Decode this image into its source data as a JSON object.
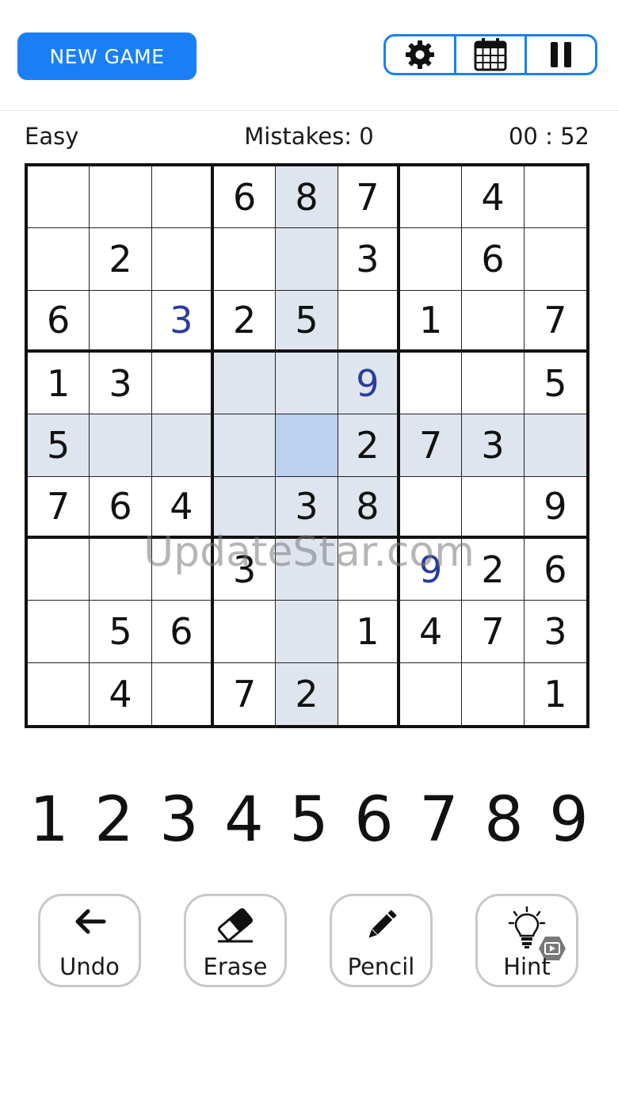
{
  "header": {
    "new_game_label": "NEW GAME",
    "icons": [
      "gear-icon",
      "calendar-icon",
      "pause-icon"
    ]
  },
  "status": {
    "difficulty": "Easy",
    "mistakes": "Mistakes: 0",
    "timer": "00 : 52"
  },
  "board": {
    "rows": [
      [
        "",
        "",
        "",
        "6",
        "8",
        "7",
        "",
        "4",
        ""
      ],
      [
        "",
        "2",
        "",
        "",
        "",
        "3",
        "",
        "6",
        ""
      ],
      [
        "6",
        "",
        "3",
        "2",
        "5",
        "",
        "1",
        "",
        "7"
      ],
      [
        "1",
        "3",
        "",
        "",
        "",
        "9",
        "",
        "",
        "5"
      ],
      [
        "5",
        "",
        "",
        "",
        "",
        "2",
        "7",
        "3",
        ""
      ],
      [
        "7",
        "6",
        "4",
        "",
        "3",
        "8",
        "",
        "",
        "9"
      ],
      [
        "",
        "",
        "",
        "3",
        "",
        "",
        "9",
        "2",
        "6"
      ],
      [
        "",
        "5",
        "6",
        "",
        "",
        "1",
        "4",
        "7",
        "3"
      ],
      [
        "",
        "4",
        "",
        "7",
        "2",
        "",
        "",
        "",
        "1"
      ]
    ],
    "user_entered": [
      [
        2,
        2
      ],
      [
        3,
        5
      ],
      [
        6,
        6
      ]
    ],
    "selected_cell": [
      4,
      4
    ],
    "colors": {
      "highlight": "#dfe5ef",
      "selected": "#bcd1ef",
      "user_digit": "#2a3d9c",
      "accent": "#1a7ff7"
    }
  },
  "watermark": "UpdateStar.com",
  "number_pad": [
    "1",
    "2",
    "3",
    "4",
    "5",
    "6",
    "7",
    "8",
    "9"
  ],
  "actions": {
    "undo": "Undo",
    "erase": "Erase",
    "pencil": "Pencil",
    "hint": "Hint"
  }
}
